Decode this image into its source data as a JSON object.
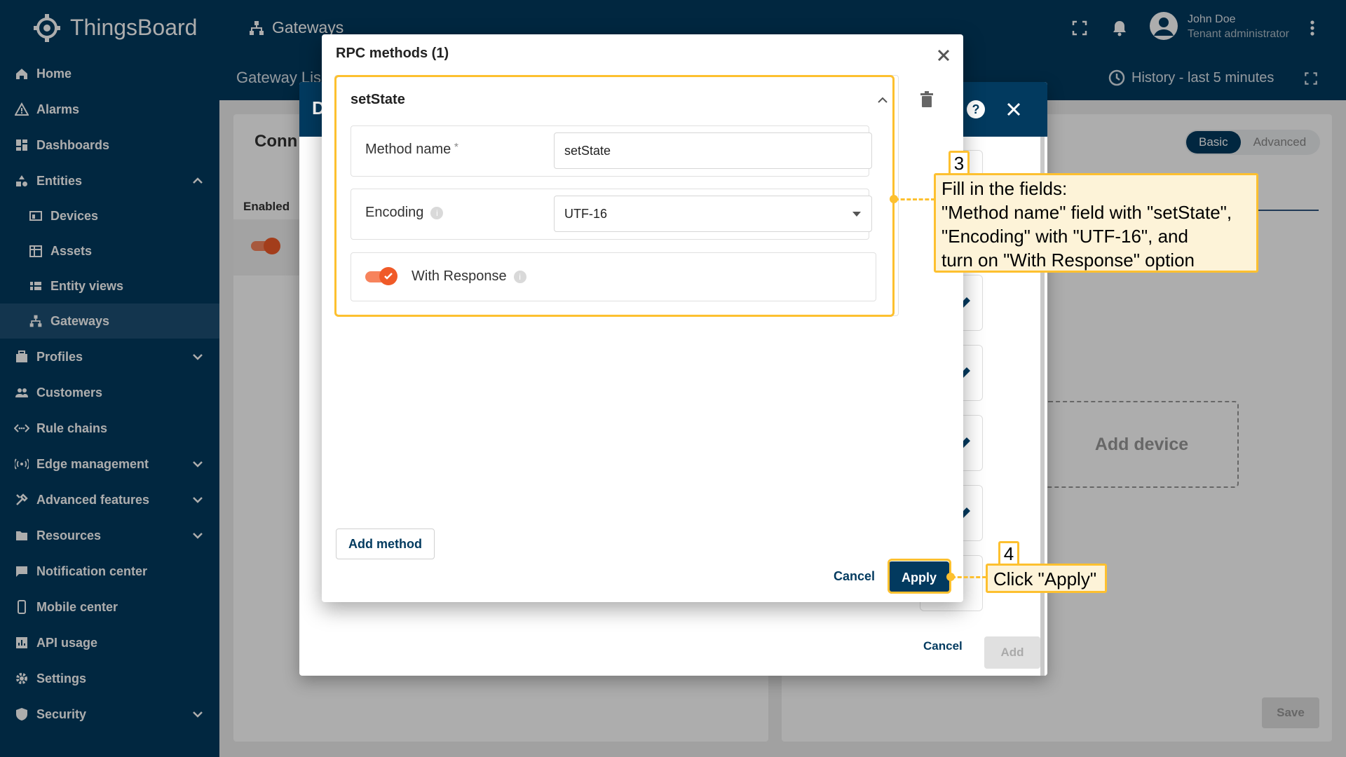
{
  "topbar": {
    "brand": "ThingsBoard",
    "page": "Gateways",
    "user_name": "John Doe",
    "user_role": "Tenant administrator"
  },
  "sidebar": {
    "items": [
      {
        "label": "Home",
        "icon": "home-icon"
      },
      {
        "label": "Alarms",
        "icon": "alarm-icon"
      },
      {
        "label": "Dashboards",
        "icon": "dashboard-icon"
      },
      {
        "label": "Entities",
        "icon": "entities-icon",
        "expanded": true
      },
      {
        "label": "Devices",
        "icon": "devices-icon",
        "sub": true
      },
      {
        "label": "Assets",
        "icon": "assets-icon",
        "sub": true
      },
      {
        "label": "Entity views",
        "icon": "entity-views-icon",
        "sub": true
      },
      {
        "label": "Gateways",
        "icon": "gateways-icon",
        "sub": true,
        "active": true
      },
      {
        "label": "Profiles",
        "icon": "profiles-icon",
        "collapsed": true
      },
      {
        "label": "Customers",
        "icon": "customers-icon"
      },
      {
        "label": "Rule chains",
        "icon": "rule-chains-icon"
      },
      {
        "label": "Edge management",
        "icon": "edge-icon",
        "collapsed": true
      },
      {
        "label": "Advanced features",
        "icon": "advanced-icon",
        "collapsed": true
      },
      {
        "label": "Resources",
        "icon": "resources-icon",
        "collapsed": true
      },
      {
        "label": "Notification center",
        "icon": "notification-icon"
      },
      {
        "label": "Mobile center",
        "icon": "mobile-icon"
      },
      {
        "label": "API usage",
        "icon": "api-usage-icon"
      },
      {
        "label": "Settings",
        "icon": "settings-icon"
      },
      {
        "label": "Security",
        "icon": "security-icon",
        "collapsed": true
      }
    ]
  },
  "main": {
    "title": "Gateway Lis",
    "history": "History - last 5 minutes",
    "conn_title": "Conn",
    "enabled_label": "Enabled",
    "seg_basic": "Basic",
    "seg_advanced": "Advanced",
    "add_device": "Add device",
    "save": "Save"
  },
  "dialog2": {
    "title_initial": "D",
    "cancel": "Cancel",
    "add": "Add"
  },
  "rpc_dialog": {
    "title": "RPC methods (1)",
    "method_title": "setState",
    "method_name_label": "Method name",
    "method_name_value": "setState",
    "encoding_label": "Encoding",
    "encoding_value": "UTF-16",
    "with_response_label": "With Response",
    "with_response_on": true,
    "add_method": "Add method",
    "cancel": "Cancel",
    "apply": "Apply"
  },
  "annotations": {
    "step3_num": "3",
    "step3_text_1": "Fill in the fields:",
    "step3_text_2": "\"Method name\" field with \"setState\",",
    "step3_text_3": "\"Encoding\" with \"UTF-16\", and",
    "step3_text_4": "turn on \"With Response\" option",
    "step4_num": "4",
    "step4_text": "Click \"Apply\""
  },
  "colors": {
    "primary": "#023a5f",
    "accent": "#f05a28",
    "highlight": "#fdc02f"
  }
}
